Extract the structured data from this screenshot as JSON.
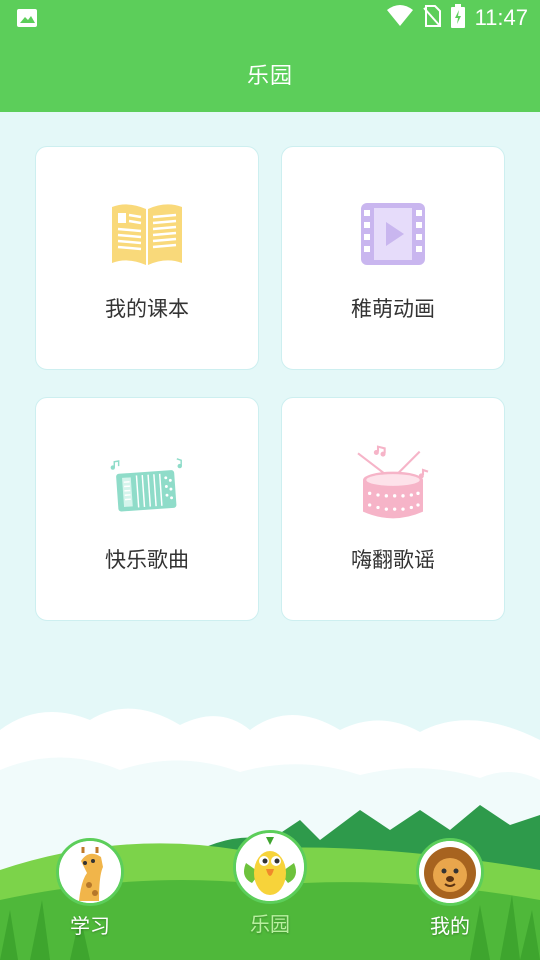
{
  "status": {
    "time": "11:47",
    "icons": [
      "image-icon",
      "wifi-icon",
      "no-sim-icon",
      "battery-charging-icon"
    ]
  },
  "header": {
    "title": "乐园"
  },
  "cards": [
    {
      "label": "我的课本",
      "icon": "open-book-icon",
      "color": "#f9d97a"
    },
    {
      "label": "稚萌动画",
      "icon": "video-icon",
      "color": "#c9b6ef"
    },
    {
      "label": "快乐歌曲",
      "icon": "accordion-icon",
      "color": "#8fdcc9"
    },
    {
      "label": "嗨翻歌谣",
      "icon": "drum-icon",
      "color": "#f6b4c8"
    }
  ],
  "nav": {
    "items": [
      {
        "label": "学习",
        "icon": "giraffe-avatar-icon"
      },
      {
        "label": "乐园",
        "icon": "parrot-avatar-icon",
        "active": true
      },
      {
        "label": "我的",
        "icon": "lion-avatar-icon"
      }
    ]
  },
  "colors": {
    "primary": "#5cce5a",
    "background": "#e4f8f8",
    "active_nav": "#b9f0a0"
  }
}
